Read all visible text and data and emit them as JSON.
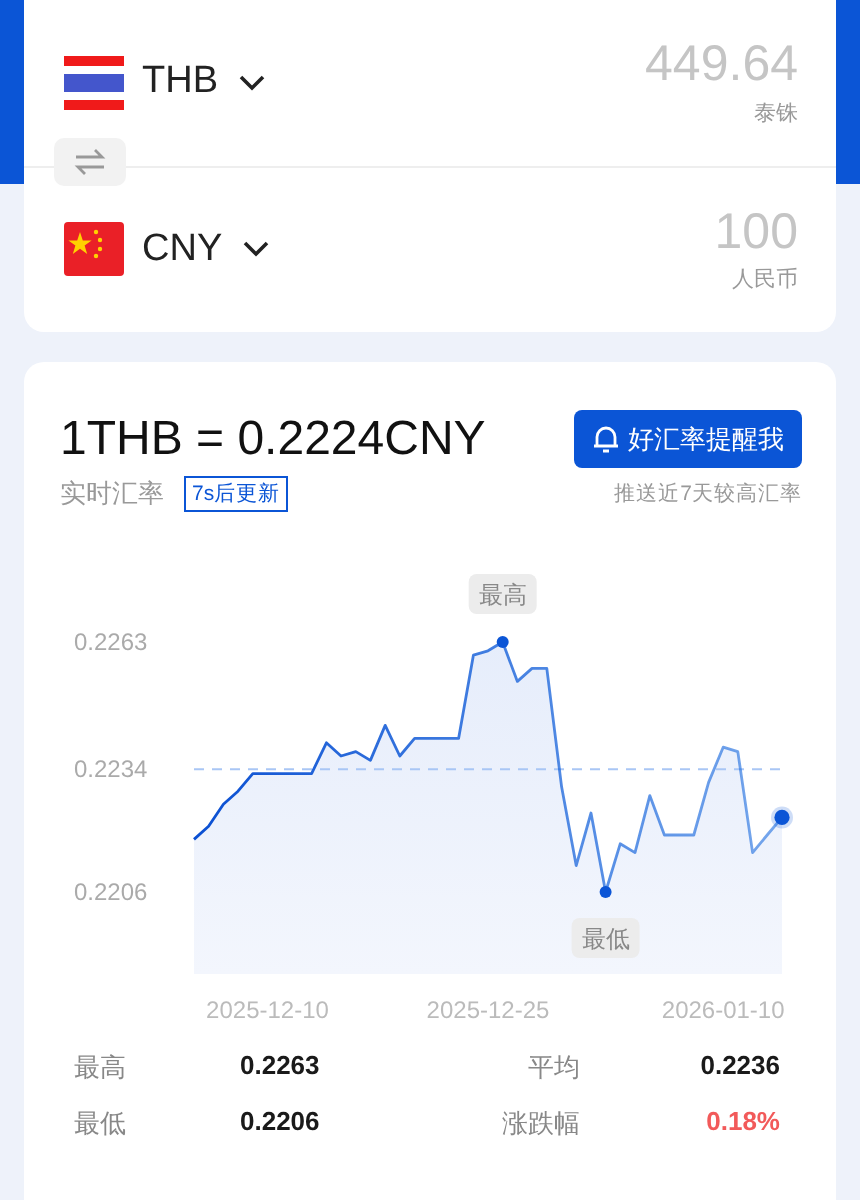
{
  "converter": {
    "rows": [
      {
        "code": "THB",
        "amount": "449.64",
        "currency_name": "泰铢"
      },
      {
        "code": "CNY",
        "amount": "100",
        "currency_name": "人民币"
      }
    ]
  },
  "rate": {
    "headline": "1THB = 0.2224CNY",
    "label": "实时汇率",
    "refresh_badge": "7s后更新",
    "alert_button": "好汇率提醒我",
    "alert_note": "推送近7天较高汇率",
    "chart_data": {
      "type": "area",
      "categories": [
        null,
        null,
        null,
        null,
        null,
        "2025-12-10",
        null,
        null,
        null,
        null,
        null,
        null,
        null,
        null,
        null,
        null,
        null,
        null,
        null,
        null,
        "2025-12-25",
        null,
        null,
        null,
        null,
        null,
        null,
        null,
        null,
        null,
        null,
        null,
        null,
        null,
        null,
        null,
        "2026-01-10",
        null,
        null,
        null,
        null
      ],
      "series": [
        {
          "color": "#1f6fe0",
          "values": [
            0.2218,
            0.2221,
            0.2226,
            0.2229,
            0.2233,
            0.2233,
            0.2233,
            0.2233,
            0.2233,
            0.224,
            0.2237,
            0.2238,
            0.2236,
            0.2244,
            0.2237,
            0.2241,
            0.2241,
            0.2241,
            0.2241,
            0.226,
            0.2261,
            0.2263,
            0.2254,
            0.2257,
            0.2257,
            0.223,
            0.2212,
            0.2224,
            0.2206,
            0.2217,
            0.2215,
            0.2228,
            0.2219,
            0.2219,
            0.2219,
            0.2231,
            0.2239,
            0.2238,
            0.2215,
            0.2219,
            0.2223
          ]
        }
      ],
      "ylim": [
        0.2206,
        0.2263
      ],
      "yticks": [
        0.2206,
        0.2234,
        0.2263
      ],
      "ref_lines": [
        {
          "axis": "y",
          "value": 0.2234
        }
      ],
      "annotations": [
        "最高",
        "最低"
      ]
    }
  },
  "stats": [
    {
      "label": "最高",
      "value": "0.2263",
      "color": "#1a1a1a"
    },
    {
      "label": "平均",
      "value": "0.2236",
      "color": "#1a1a1a"
    },
    {
      "label": "最低",
      "value": "0.2206",
      "color": "#1a1a1a"
    },
    {
      "label": "涨跌幅",
      "value": "0.18%",
      "color": "#f25a5a"
    }
  ]
}
